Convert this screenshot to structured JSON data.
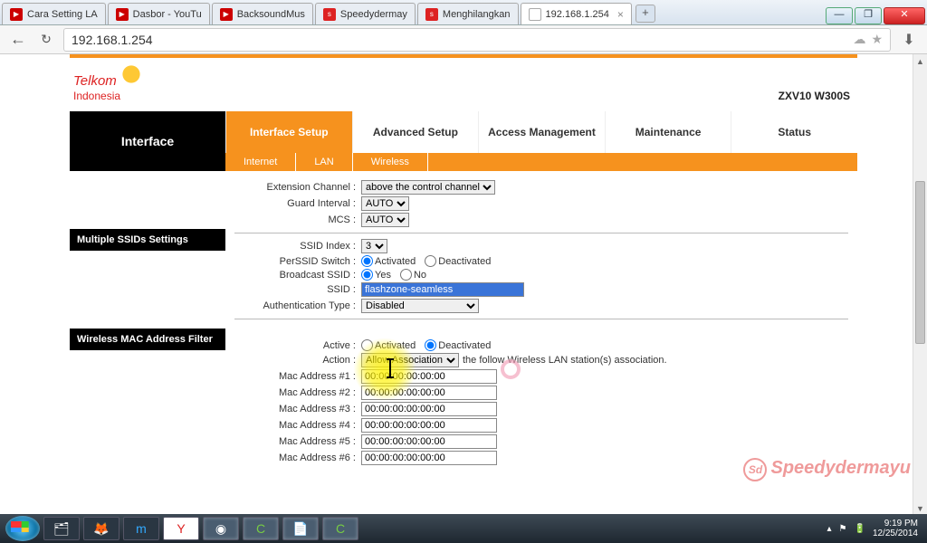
{
  "browser": {
    "tabs": [
      {
        "label": "Cara Setting LA",
        "favicon": "yt"
      },
      {
        "label": "Dasbor - YouTu",
        "favicon": "yt"
      },
      {
        "label": "BacksoundMus",
        "favicon": "yt"
      },
      {
        "label": "Speedydermay",
        "favicon": "red"
      },
      {
        "label": "Menghilangkan",
        "favicon": "red"
      },
      {
        "label": "192.168.1.254",
        "favicon": "none",
        "active": true
      }
    ],
    "url": "192.168.1.254"
  },
  "page": {
    "brand_line1": "Telkom",
    "brand_line2": "Indonesia",
    "model": "ZXV10 W300S",
    "nav_side": "Interface",
    "nav_tabs": [
      "Interface Setup",
      "Advanced Setup",
      "Access Management",
      "Maintenance",
      "Status"
    ],
    "sub_tabs": [
      "Internet",
      "LAN",
      "Wireless"
    ],
    "sections": {
      "ext_channel": {
        "label": "Extension Channel :",
        "value": "above the control channel"
      },
      "guard": {
        "label": "Guard Interval :",
        "value": "AUTO"
      },
      "mcs": {
        "label": "MCS :",
        "value": "AUTO"
      },
      "multi_hdr": "Multiple SSIDs Settings",
      "ssid_index": {
        "label": "SSID Index :",
        "value": "3"
      },
      "perssid": {
        "label": "PerSSID Switch :",
        "opt_on": "Activated",
        "opt_off": "Deactivated"
      },
      "broadcast": {
        "label": "Broadcast SSID :",
        "opt_yes": "Yes",
        "opt_no": "No"
      },
      "ssid": {
        "label": "SSID :",
        "value": "flashzone-seamless"
      },
      "auth": {
        "label": "Authentication Type :",
        "value": "Disabled"
      },
      "mac_hdr": "Wireless MAC Address Filter",
      "active": {
        "label": "Active :",
        "opt_on": "Activated",
        "opt_off": "Deactivated"
      },
      "action": {
        "label": "Action :",
        "value": "Allow Association",
        "note": "the follow Wireless LAN station(s) association."
      },
      "mac_rows": [
        {
          "label": "Mac Address #1 :",
          "value": "00:00:00:00:00:00"
        },
        {
          "label": "Mac Address #2 :",
          "value": "00:00:00:00:00:00"
        },
        {
          "label": "Mac Address #3 :",
          "value": "00:00:00:00:00:00"
        },
        {
          "label": "Mac Address #4 :",
          "value": "00:00:00:00:00:00"
        },
        {
          "label": "Mac Address #5 :",
          "value": "00:00:00:00:00:00"
        },
        {
          "label": "Mac Address #6 :",
          "value": "00:00:00:00:00:00"
        }
      ]
    }
  },
  "watermark": "Speedydermayu",
  "taskbar": {
    "time": "9:19 PM",
    "date": "12/25/2014"
  }
}
